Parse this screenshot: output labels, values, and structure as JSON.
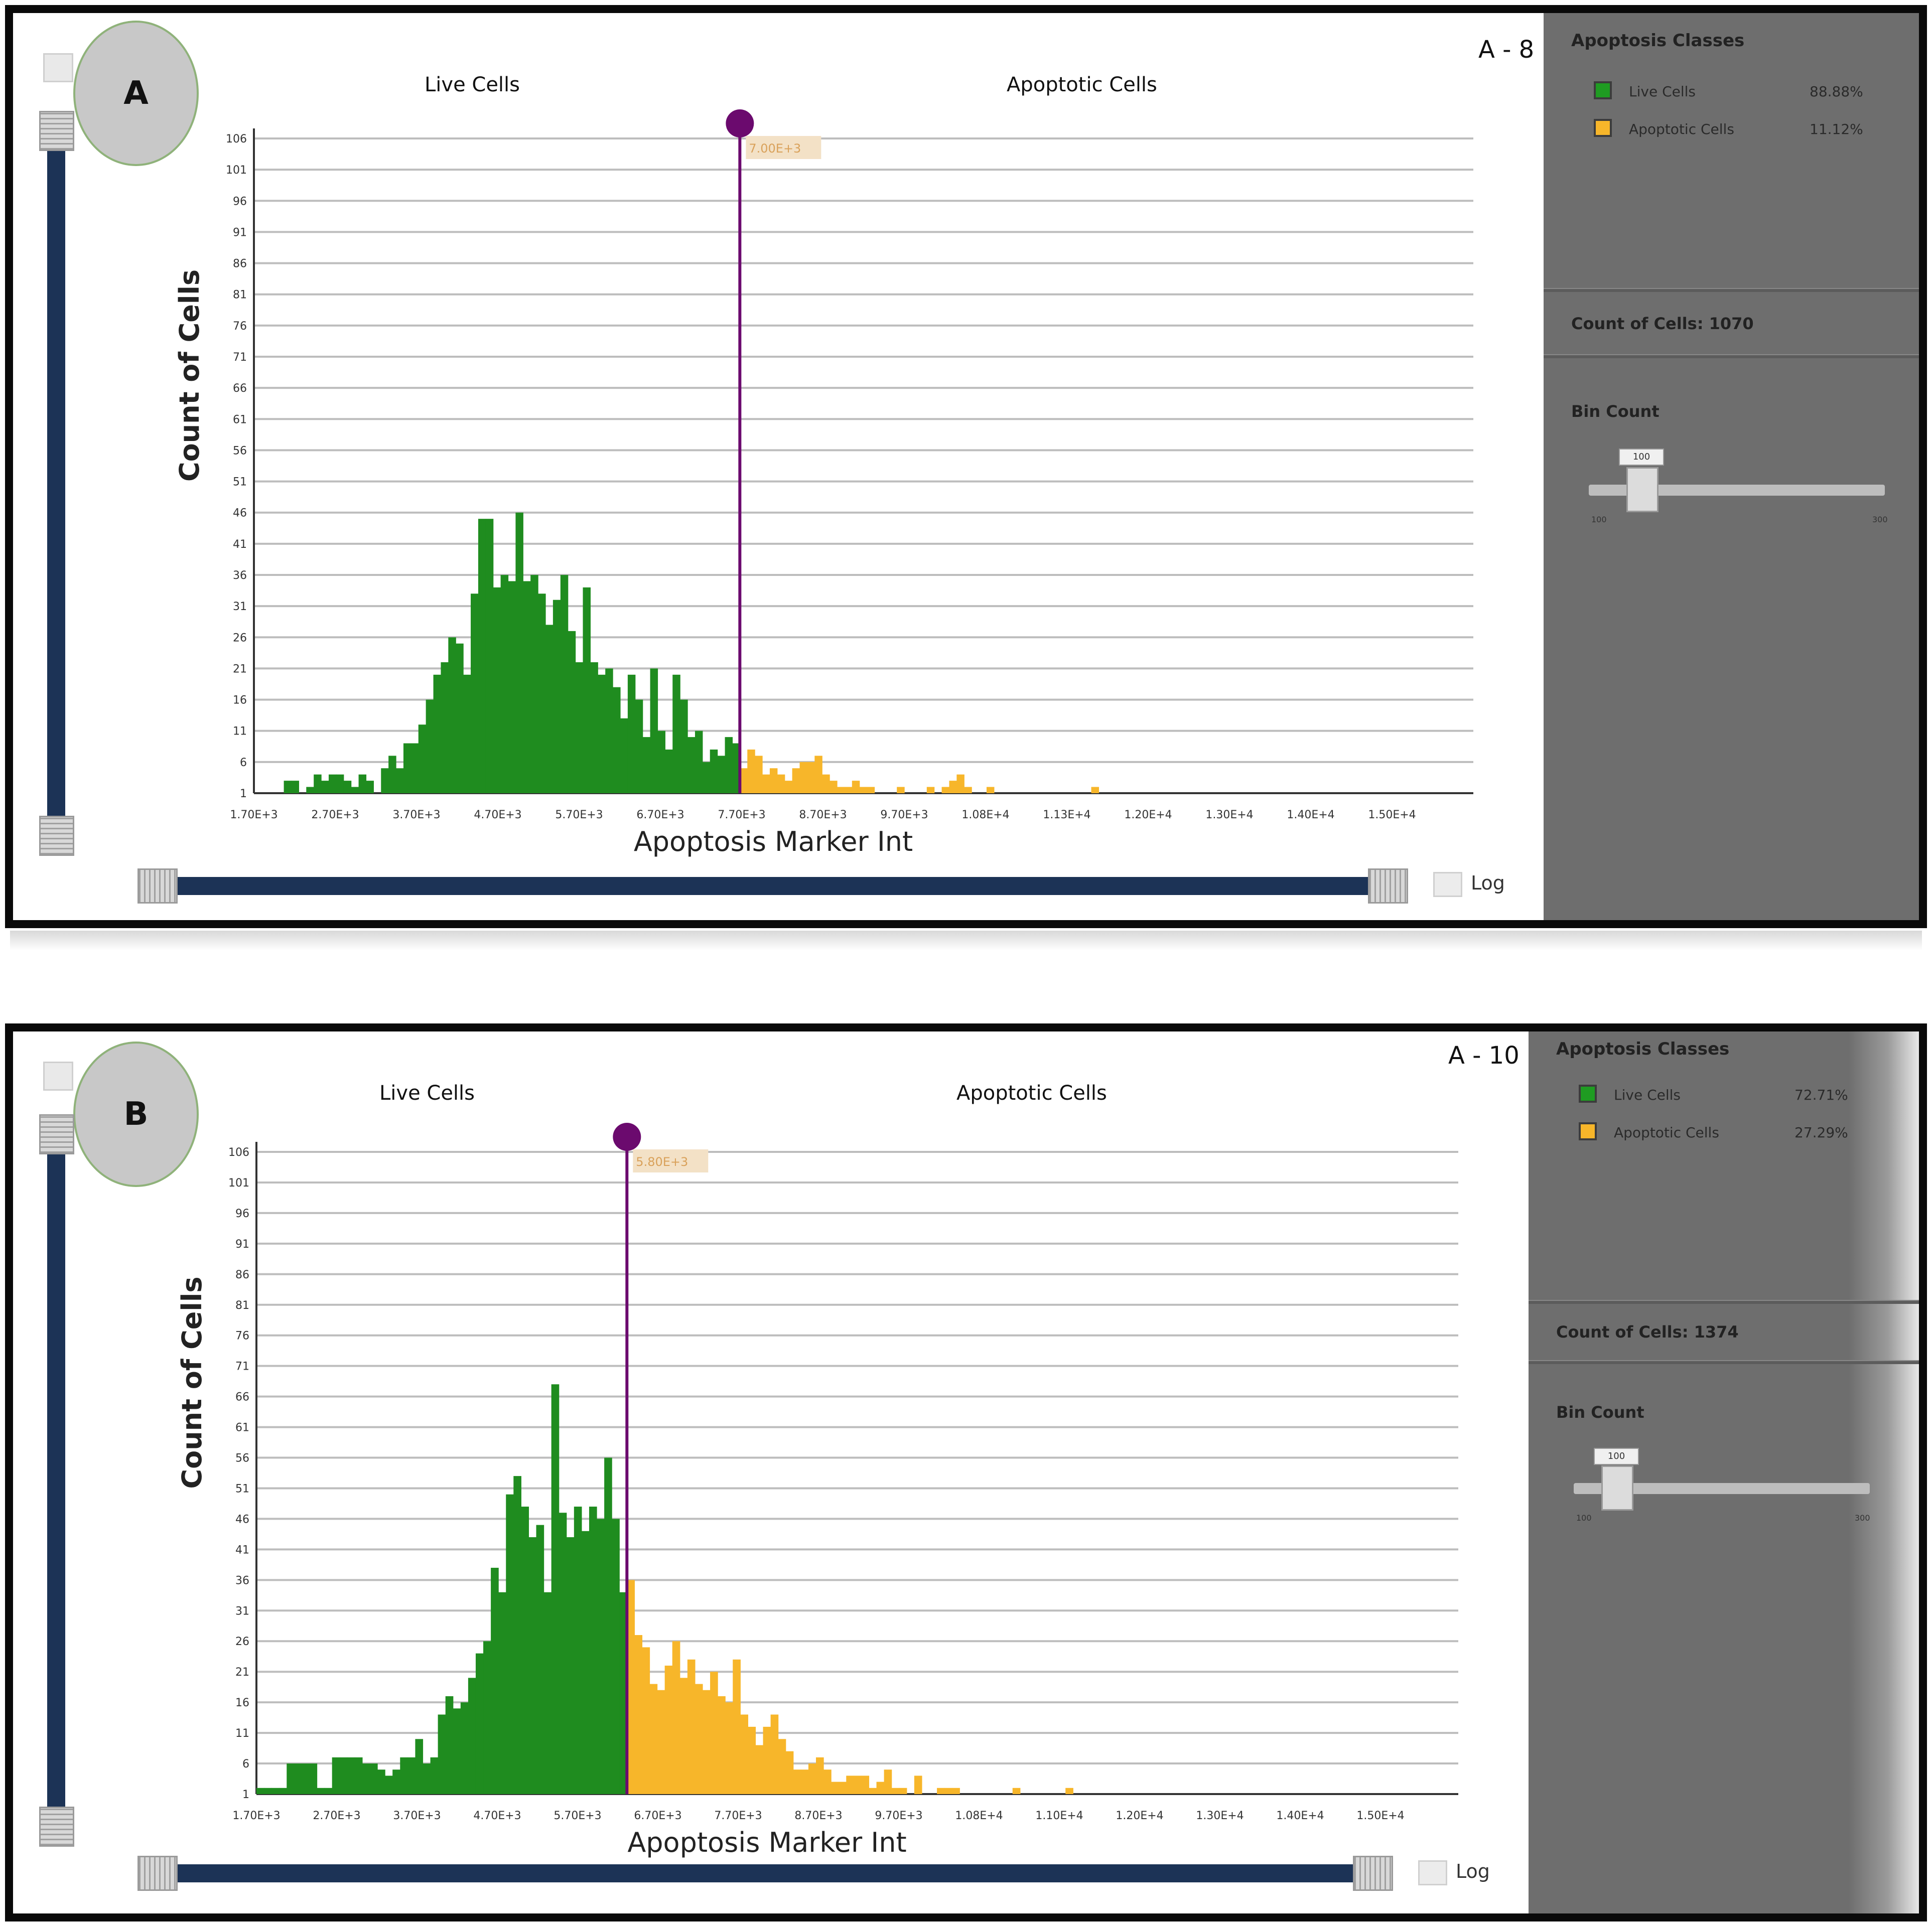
{
  "panels": [
    {
      "letter": "A",
      "well": "A - 8",
      "regions": [
        "Live Cells",
        "Apoptotic Cells"
      ],
      "side": {
        "title": "Apoptosis Classes",
        "legend": [
          {
            "label": "Live Cells",
            "value": "88.88%",
            "color": "#1f9c22"
          },
          {
            "label": "Apoptotic Cells",
            "value": "11.12%",
            "color": "#f7b62a"
          }
        ],
        "count": "Count of Cells: 1070",
        "bin_label": "Bin Count",
        "bin_value": "100",
        "bin_min": "100",
        "bin_max": "300"
      },
      "log_label": "Log"
    },
    {
      "letter": "B",
      "well": "A - 10",
      "regions": [
        "Live Cells",
        "Apoptotic Cells"
      ],
      "side": {
        "title": "Apoptosis Classes",
        "legend": [
          {
            "label": "Live Cells",
            "value": "72.71%",
            "color": "#1f9c22"
          },
          {
            "label": "Apoptotic Cells",
            "value": "27.29%",
            "color": "#f7b62a"
          }
        ],
        "count": "Count of Cells: 1374",
        "bin_label": "Bin Count",
        "bin_value": "100",
        "bin_min": "100",
        "bin_max": "300"
      },
      "log_label": "Log"
    }
  ],
  "chart_data": [
    {
      "type": "bar",
      "xlabel": "Apoptosis Marker Int",
      "ylabel": "Count of Cells",
      "x_ticks": [
        "1.70E+3",
        "2.70E+3",
        "3.70E+3",
        "4.70E+3",
        "5.70E+3",
        "6.70E+3",
        "7.70E+3",
        "8.70E+3",
        "9.70E+3",
        "1.08E+4",
        "1.13E+4",
        "1.20E+4",
        "1.30E+4",
        "1.40E+4",
        "1.50E+4"
      ],
      "y_ticks": [
        "1",
        "6",
        "11",
        "16",
        "21",
        "26",
        "31",
        "36",
        "41",
        "46",
        "51",
        "56",
        "61",
        "66",
        "71",
        "76",
        "81",
        "86",
        "91",
        "96",
        "101",
        "106"
      ],
      "xlim": [
        1700,
        15000
      ],
      "ylim": [
        1,
        106
      ],
      "threshold": 7000,
      "threshold_label": "7.00E+3",
      "series": [
        {
          "name": "Live Cells",
          "color": "#1f8c1f",
          "values": [
            1,
            1,
            1,
            1,
            3,
            3,
            1,
            2,
            4,
            3,
            4,
            4,
            3,
            2,
            4,
            3,
            1,
            5,
            7,
            5,
            9,
            9,
            12,
            16,
            20,
            22,
            26,
            25,
            20,
            33,
            45,
            45,
            34,
            36,
            35,
            46,
            35,
            36,
            33,
            28,
            32,
            36,
            27,
            22,
            34,
            22,
            20,
            21,
            18,
            13,
            20,
            16,
            10,
            21,
            11,
            8,
            20,
            16,
            10,
            11,
            6,
            8,
            7,
            10,
            9
          ]
        },
        {
          "name": "Apoptotic Cells",
          "color": "#f7b62a",
          "values": [
            5,
            8,
            7,
            4,
            5,
            4,
            3,
            5,
            6,
            6,
            7,
            4,
            3,
            2,
            2,
            3,
            2,
            2,
            1,
            1,
            1,
            2,
            1,
            1,
            1,
            2,
            1,
            2,
            3,
            4,
            2,
            1,
            1,
            2,
            1,
            1,
            1,
            1,
            1,
            1,
            1,
            1,
            1,
            1,
            1,
            1,
            1,
            2,
            1,
            1,
            1
          ]
        }
      ]
    },
    {
      "type": "bar",
      "xlabel": "Apoptosis Marker Int",
      "ylabel": "Count of Cells",
      "x_ticks": [
        "1.70E+3",
        "2.70E+3",
        "3.70E+3",
        "4.70E+3",
        "5.70E+3",
        "6.70E+3",
        "7.70E+3",
        "8.70E+3",
        "9.70E+3",
        "1.08E+4",
        "1.10E+4",
        "1.20E+4",
        "1.30E+4",
        "1.40E+4",
        "1.50E+4"
      ],
      "y_ticks": [
        "1",
        "6",
        "11",
        "16",
        "21",
        "26",
        "31",
        "36",
        "41",
        "46",
        "51",
        "56",
        "61",
        "66",
        "71",
        "76",
        "81",
        "86",
        "91",
        "96",
        "101",
        "106"
      ],
      "xlim": [
        1700,
        15000
      ],
      "ylim": [
        1,
        106
      ],
      "threshold": 5800,
      "threshold_label": "5.80E+3",
      "series": [
        {
          "name": "Live Cells",
          "color": "#1f8c1f",
          "values": [
            2,
            2,
            2,
            2,
            6,
            6,
            6,
            6,
            2,
            2,
            7,
            7,
            7,
            7,
            6,
            6,
            5,
            4,
            5,
            7,
            7,
            10,
            6,
            7,
            14,
            17,
            15,
            16,
            20,
            24,
            26,
            38,
            34,
            50,
            53,
            48,
            43,
            45,
            34,
            68,
            47,
            43,
            48,
            44,
            48,
            46,
            56,
            46,
            34
          ]
        },
        {
          "name": "Apoptotic Cells",
          "color": "#f7b62a",
          "values": [
            36,
            27,
            25,
            19,
            18,
            22,
            26,
            20,
            23,
            19,
            18,
            21,
            17,
            16,
            23,
            14,
            12,
            9,
            12,
            14,
            10,
            8,
            5,
            5,
            6,
            7,
            5,
            3,
            3,
            4,
            4,
            4,
            2,
            3,
            5,
            2,
            2,
            1,
            4,
            1,
            1,
            2,
            2,
            2,
            1,
            1,
            1,
            1,
            1,
            1,
            1,
            2,
            1,
            1,
            1,
            1,
            1,
            1,
            2,
            1,
            1
          ]
        }
      ]
    }
  ]
}
